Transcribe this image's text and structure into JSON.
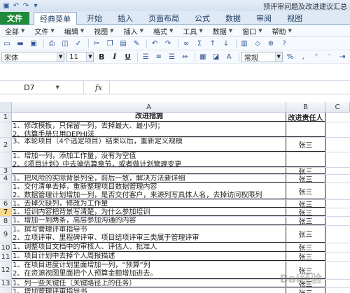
{
  "title_bar": {
    "document_title": "预评审问题及改进建议汇总",
    "qat": [
      "save-icon",
      "undo-icon",
      "redo-icon",
      "customize-icon"
    ]
  },
  "tabs": [
    "文件",
    "经典菜单",
    "开始",
    "插入",
    "页面布局",
    "公式",
    "数据",
    "审阅",
    "视图"
  ],
  "menu_items": [
    "全部",
    "文件",
    "编辑",
    "视图",
    "插入",
    "格式",
    "工具",
    "数据",
    "窗口",
    "帮助"
  ],
  "toolbar": {
    "font_name": "宋体",
    "font_size": "11",
    "number_format": "常规",
    "bold": "B",
    "italic": "I",
    "underline": "U"
  },
  "formula_bar": {
    "cell_ref": "D7",
    "fx": "fx"
  },
  "columns": [
    "A",
    "B",
    "C"
  ],
  "header_row": {
    "row": "1",
    "a": "改进措施",
    "b": "改进责任人"
  },
  "rows": [
    {
      "num": "",
      "lines": [
        "1、修改模板，只保留一列，去掉最大、最小列；",
        "2、估算手册只用DEPHI法"
      ],
      "b": ""
    },
    {
      "num": "2",
      "lines": [
        "3、本轮项目（4个选定项目）结束以后，重新定义规模"
      ],
      "b": "张三"
    },
    {
      "num": "",
      "lines": [
        "1、增加一列，添加工作量，没有为空值",
        "2、《项目计划》中去掉估算章节，或者做计划管理变更"
      ],
      "b": ""
    },
    {
      "num": "3",
      "lines": [],
      "b": "张三"
    },
    {
      "num": "4",
      "lines": [
        "1、把风险的实际背景列全，前后一致，解决方法要详细"
      ],
      "b": "张三"
    },
    {
      "num": "",
      "lines": [
        "1、交付清单去掉，重新整理项目数据管理内容",
        "2、数据管理计划增加一列，是否交付客户，来源列写具体人名，去掉访问权限列"
      ],
      "b": "张三"
    },
    {
      "num": "6",
      "lines": [
        "1、去掉欠缺列，修改为工作量"
      ],
      "b": "张三"
    },
    {
      "num": "7",
      "lines": [
        "1、培训内容把背景写清楚，为什么参加培训"
      ],
      "b": "张三"
    },
    {
      "num": "8",
      "lines": [
        "1、增加一到两条，高层参加沟通的内容"
      ],
      "b": "张三"
    },
    {
      "num": "9",
      "lines": [
        "1、撰写管理评审指导书",
        "2、立项评审、里程碑评审、项目结项评审三类属于管理评审"
      ],
      "b": "张三"
    },
    {
      "num": "10",
      "lines": [
        "1、调整项目文档中的审核人、评估人、批准人"
      ],
      "b": "张三"
    },
    {
      "num": "11",
      "lines": [
        "1、项目计划中去掉个人周报描述"
      ],
      "b": "张三"
    },
    {
      "num": "12",
      "lines": [
        "1、在项目进度计划里面增加一列，“预算”列",
        "2、在资源视图里面把个人预算金额增加进去。"
      ],
      "b": "张三"
    },
    {
      "num": "13",
      "lines": [
        "1、列一些关键任（关键路径上的任务）"
      ],
      "b": "张三"
    },
    {
      "num": "",
      "lines": [
        "1、增加管理评审指导书"
      ],
      "b": "张三"
    }
  ],
  "watermark": "Bai经验"
}
